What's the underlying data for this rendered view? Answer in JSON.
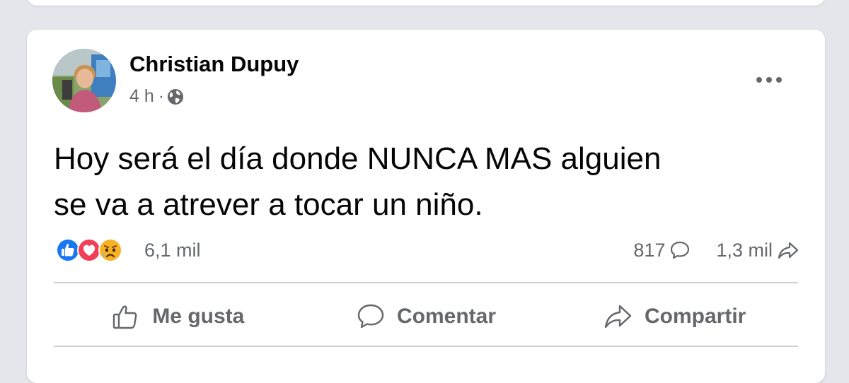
{
  "post": {
    "author": "Christian Dupuy",
    "timestamp": "4 h",
    "separator": "·",
    "audience_icon": "globe-icon",
    "text_line1": "Hoy será el día donde NUNCA MAS alguien",
    "text_line2": "se va a atrever a tocar un niño.",
    "reactions": {
      "types": [
        "like",
        "love",
        "sad"
      ],
      "count": "6,1 mil"
    },
    "comments_count": "817",
    "shares_count": "1,3 mil"
  },
  "actions": {
    "like_label": "Me gusta",
    "comment_label": "Comentar",
    "share_label": "Compartir"
  },
  "colors": {
    "like_blue": "#1877f2",
    "love_red": "#f33e58",
    "sad_yellow": "#f7b125",
    "text_primary": "#050505",
    "text_secondary": "#65676b",
    "background": "#e4e6eb",
    "card": "#ffffff"
  }
}
